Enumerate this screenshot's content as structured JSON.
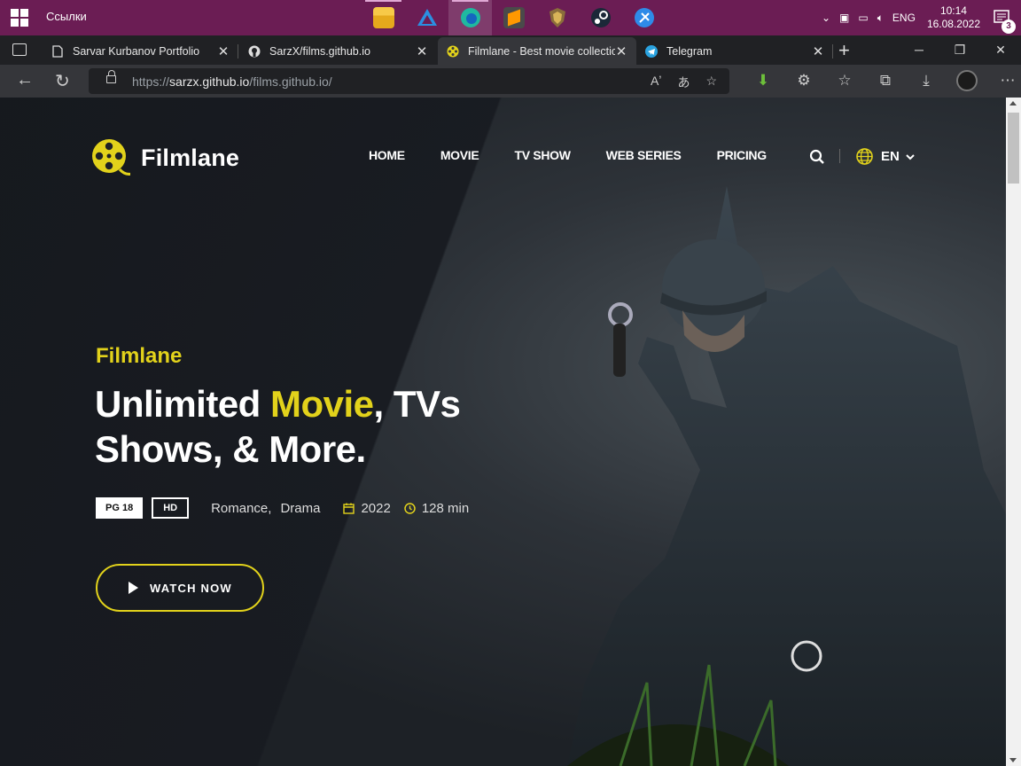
{
  "taskbar": {
    "links_label": "Ссылки",
    "lang": "ENG",
    "time": "10:14",
    "date": "16.08.2022",
    "notification_count": "3",
    "pinned_apps": [
      "file-explorer",
      "app-triangle",
      "edge",
      "sublime-text",
      "app-shield",
      "steam",
      "app-blue"
    ]
  },
  "browser": {
    "tabs": [
      {
        "title": "Sarvar Kurbanov Portfolio",
        "active": false
      },
      {
        "title": "SarzX/films.github.io",
        "active": false
      },
      {
        "title": "Filmlane - Best movie collection",
        "active": true
      },
      {
        "title": "Telegram",
        "active": false
      }
    ],
    "url_prefix": "https://",
    "url_host": "sarzx.github.io",
    "url_path": "/films.github.io/"
  },
  "site": {
    "brand": "Filmlane",
    "nav": [
      "HOME",
      "MOVIE",
      "TV SHOW",
      "WEB SERIES",
      "PRICING"
    ],
    "language": "EN",
    "hero": {
      "subtitle": "Filmlane",
      "headline_part1": "Unlimited ",
      "headline_highlight": "Movie",
      "headline_part2": ", TVs",
      "headline_line2": "Shows, & More.",
      "badge_rating": "PG 18",
      "badge_quality": "HD",
      "genres": [
        "Romance,",
        "Drama"
      ],
      "year": "2022",
      "duration": "128 min",
      "cta": "WATCH NOW"
    },
    "colors": {
      "accent": "#e2d21b",
      "taskbar": "#6b1d54"
    }
  }
}
